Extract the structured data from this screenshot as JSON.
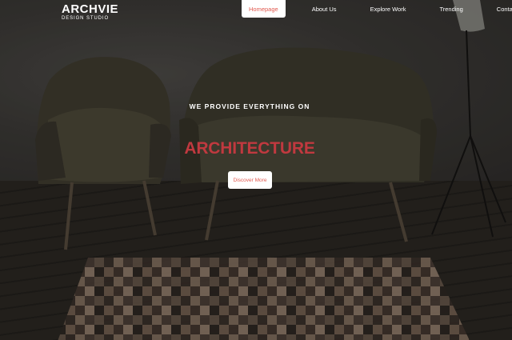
{
  "brand": {
    "name": "ARCHVIE",
    "tagline": "DESIGN STUDIO"
  },
  "nav": {
    "items": [
      {
        "label": "Homepage",
        "active": true
      },
      {
        "label": "About Us",
        "active": false
      },
      {
        "label": "Explore Work",
        "active": false
      },
      {
        "label": "Trending",
        "active": false
      },
      {
        "label": "Contact Us",
        "active": false
      }
    ]
  },
  "hero": {
    "subtitle": "WE PROVIDE EVERYTHING ON",
    "title": "ARCHITECTURE",
    "cta_label": "Discover More"
  },
  "colors": {
    "accent": "#c0393f",
    "nav_active_text": "#e25a50",
    "text": "#ffffff"
  }
}
